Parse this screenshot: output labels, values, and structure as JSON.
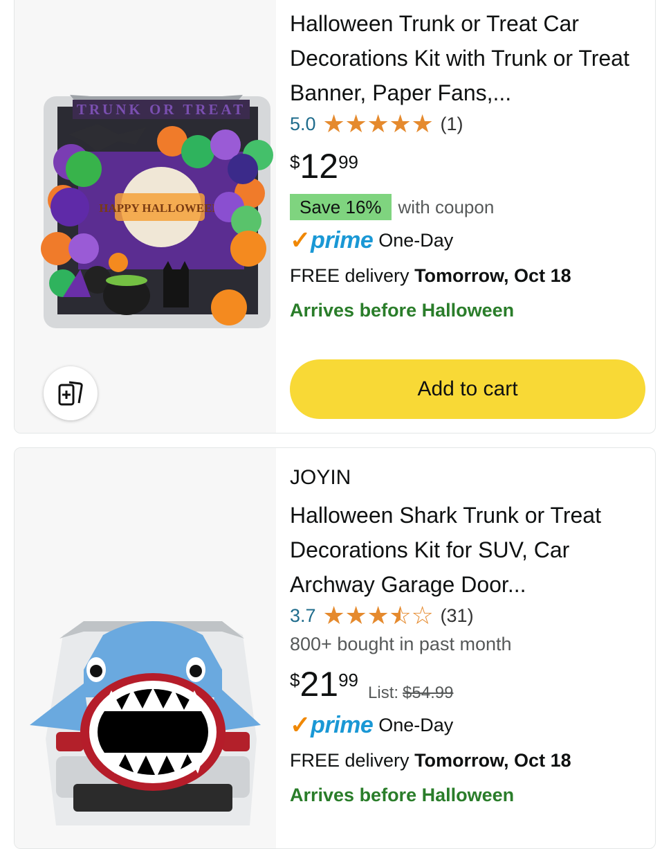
{
  "products": [
    {
      "title": "Halloween Trunk or Treat Car Decorations Kit with Trunk or Treat Banner, Paper Fans,...",
      "image": {
        "banner_text": "TRUNK OR TREAT",
        "sign_text": "HAPPY HALLOWEEN"
      },
      "rating": "5.0",
      "stars": 5,
      "review_count": "(1)",
      "price": {
        "symbol": "$",
        "whole": "12",
        "fraction": "99"
      },
      "coupon": {
        "badge": "Save 16%",
        "text": "with coupon"
      },
      "prime": {
        "check": "✓",
        "word": "prime",
        "speed": "One-Day"
      },
      "delivery": {
        "prefix": "FREE delivery",
        "date": "Tomorrow, Oct 18"
      },
      "arrives": "Arrives before Halloween",
      "add_to_cart": "Add to cart"
    },
    {
      "brand": "JOYIN",
      "title": "Halloween Shark Trunk or Treat Decorations Kit for SUV, Car Archway Garage Door...",
      "rating": "3.7",
      "stars": 3.5,
      "review_count": "(31)",
      "bought": "800+ bought in past month",
      "price": {
        "symbol": "$",
        "whole": "21",
        "fraction": "99"
      },
      "list_price": {
        "label": "List:",
        "value": "$54.99"
      },
      "prime": {
        "check": "✓",
        "word": "prime",
        "speed": "One-Day"
      },
      "delivery": {
        "prefix": "FREE delivery",
        "date": "Tomorrow, Oct 18"
      },
      "arrives": "Arrives before Halloween"
    }
  ],
  "colors": {
    "star": "#e58a2e",
    "rating_link": "#1f6c8c",
    "coupon_badge": "#7fd47f",
    "prime_check": "#f08804",
    "prime_word": "#1a98d5",
    "arrives": "#2a7d2a",
    "add_to_cart": "#f8d936"
  },
  "icons": [
    "compare-icon",
    "star-icon",
    "prime-check-icon"
  ]
}
